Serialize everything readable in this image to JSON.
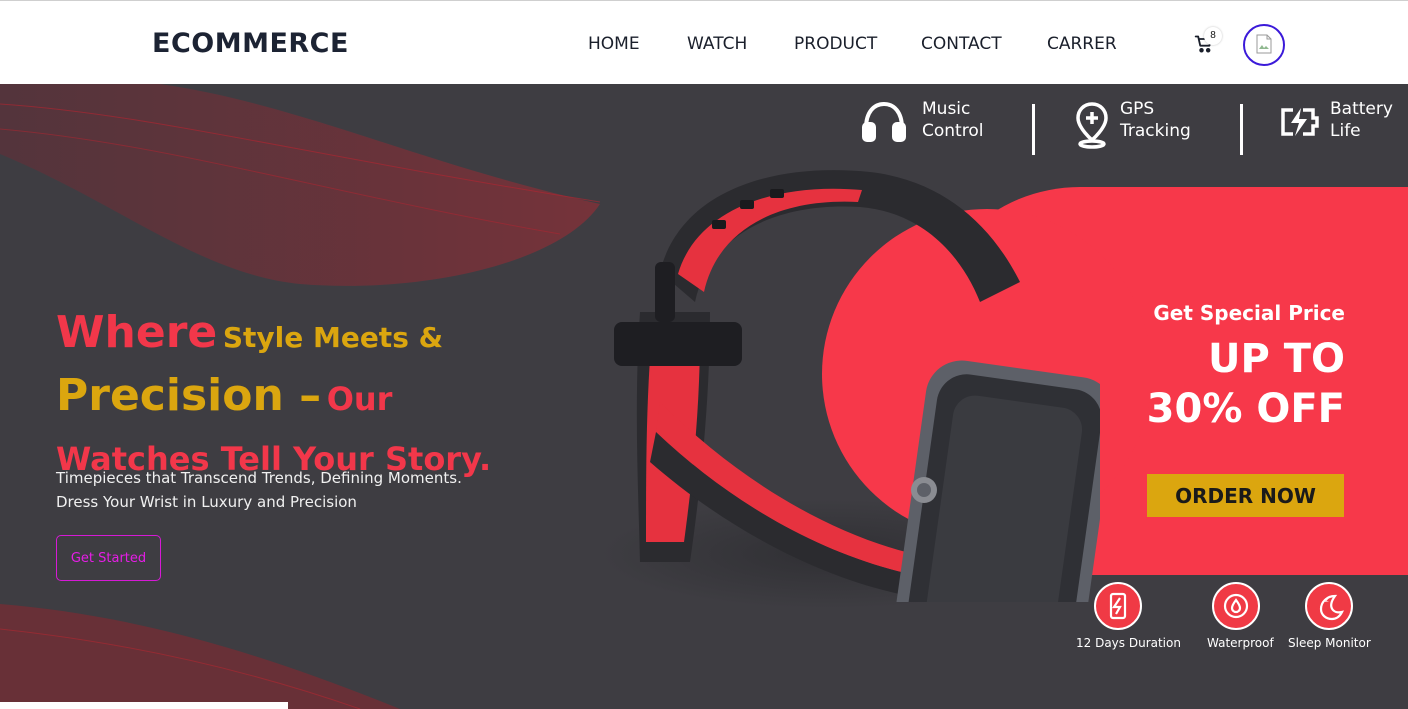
{
  "brand": {
    "logo_text": "ECOMMERCE"
  },
  "nav": {
    "items": [
      {
        "label": "HOME"
      },
      {
        "label": "WATCH"
      },
      {
        "label": "PRODUCT"
      },
      {
        "label": "CONTACT"
      },
      {
        "label": "CARRER"
      }
    ]
  },
  "cart": {
    "count": "8",
    "icon": "cart-icon"
  },
  "avatar": {
    "icon": "broken-image-icon"
  },
  "features": [
    {
      "icon": "headphones-icon",
      "line1": "Music",
      "line2": "Control"
    },
    {
      "icon": "gps-pin-icon",
      "line1": "GPS",
      "line2": "Tracking"
    },
    {
      "icon": "battery-bolt-icon",
      "line1": "Battery",
      "line2": "Life"
    }
  ],
  "hero": {
    "headline": {
      "w1": "Where",
      "w2": "Style Meets &",
      "w3": "Precision –",
      "w4": "Our",
      "w5": "Watches Tell Your Story."
    },
    "subtext": "Timepieces that Transcend Trends, Defining Moments. Dress Your Wrist in Luxury and Precision",
    "cta_label": "Get Started"
  },
  "promo": {
    "subtitle": "Get Special Price",
    "line1": "UP TO",
    "line2": "30% OFF",
    "order_label": "ORDER NOW"
  },
  "badges": [
    {
      "icon": "battery-duration-icon",
      "label": "12 Days Duration"
    },
    {
      "icon": "waterproof-icon",
      "label": "Waterproof"
    },
    {
      "icon": "sleep-moon-icon",
      "label": "Sleep Monitor"
    }
  ],
  "colors": {
    "accent_red": "#f7384a",
    "accent_gold": "#dba60f",
    "hero_bg": "#3e3d42",
    "cta_magenta": "#e61de6",
    "avatar_ring": "#3b1ad9"
  }
}
